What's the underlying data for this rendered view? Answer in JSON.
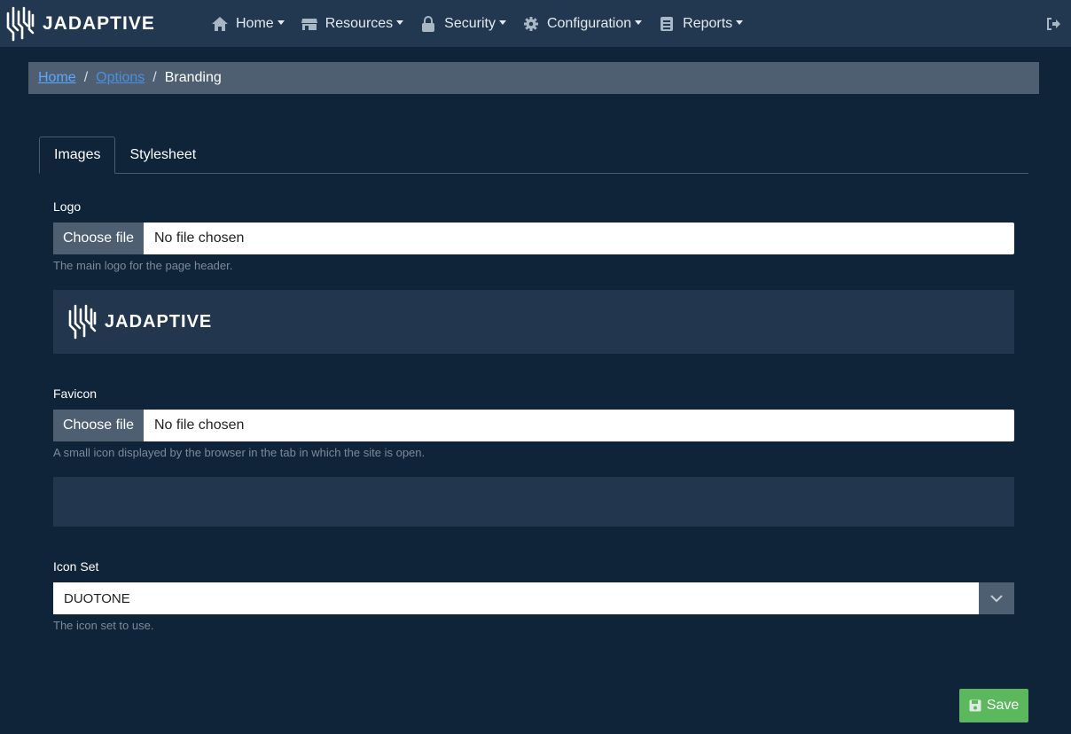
{
  "brand": {
    "name": "JADAPTIVE"
  },
  "nav": {
    "items": [
      {
        "label": "Home",
        "icon": "home-icon"
      },
      {
        "label": "Resources",
        "icon": "store-icon"
      },
      {
        "label": "Security",
        "icon": "lock-icon"
      },
      {
        "label": "Configuration",
        "icon": "gear-icon"
      },
      {
        "label": "Reports",
        "icon": "report-icon"
      }
    ],
    "logout_icon": "sign-out-icon"
  },
  "breadcrumb": {
    "home": "Home",
    "options": "Options",
    "current": "Branding",
    "separator": "/"
  },
  "tabs": [
    {
      "label": "Images",
      "active": true
    },
    {
      "label": "Stylesheet",
      "active": false
    }
  ],
  "form": {
    "logo": {
      "label": "Logo",
      "button": "Choose file",
      "file": "No file chosen",
      "help": "The main logo for the page header.",
      "preview_text": "JADAPTIVE"
    },
    "favicon": {
      "label": "Favicon",
      "button": "Choose file",
      "file": "No file chosen",
      "help": "A small icon displayed by the browser in the tab in which the site is open."
    },
    "icon_set": {
      "label": "Icon Set",
      "value": "DUOTONE",
      "help": "The icon set to use."
    }
  },
  "actions": {
    "save": "Save"
  },
  "colors": {
    "background": "#0f2339",
    "navbar": "#223850",
    "breadcrumb": "#4d5f70",
    "save": "#5cb85c",
    "link": "#4a90e2"
  }
}
